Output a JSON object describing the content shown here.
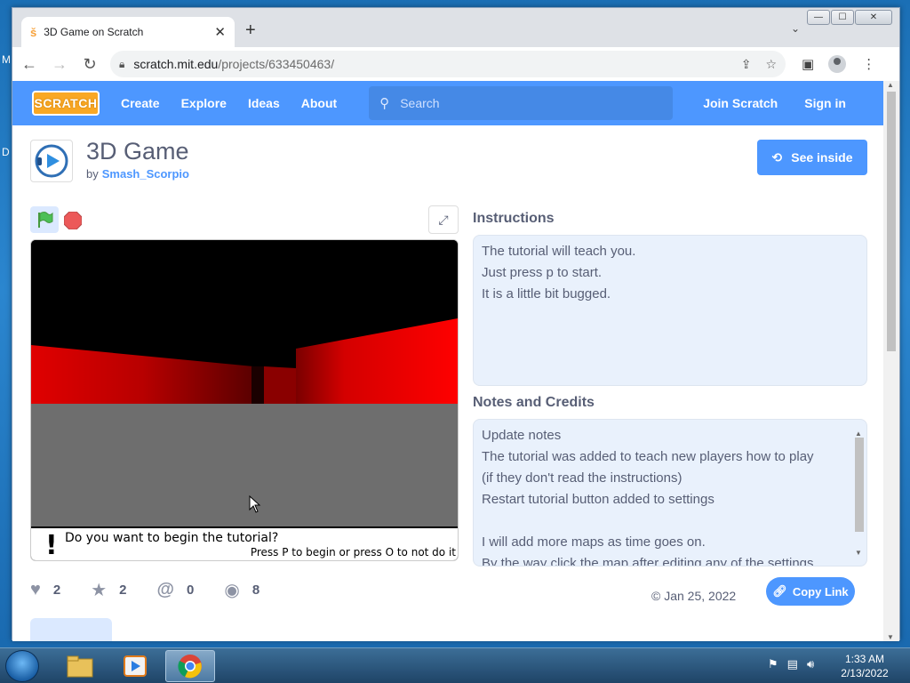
{
  "desktop": {
    "glyphs": [
      "M",
      "D"
    ]
  },
  "browser": {
    "tab_title": "3D Game on Scratch",
    "tab_favicon": "scratch-icon",
    "new_tab_label": "+",
    "url_host": "scratch.mit.edu",
    "url_path": "/projects/633450463/",
    "window_buttons": {
      "minimize": "—",
      "maximize": "☐",
      "close": "✕"
    }
  },
  "nav": {
    "logo": "SCRATCH",
    "links": [
      "Create",
      "Explore",
      "Ideas",
      "About"
    ],
    "search_placeholder": "Search",
    "join": "Join Scratch",
    "signin": "Sign in"
  },
  "project": {
    "title": "3D Game",
    "by_prefix": "by",
    "author": "Smash_Scorpio",
    "see_inside": "See inside"
  },
  "stage": {
    "question": "Do you want to begin the tutorial?",
    "hint": "Press P to begin or press O to not do it",
    "bang": "!"
  },
  "instructions": {
    "heading": "Instructions",
    "lines": [
      "The tutorial will teach you.",
      "Just press p to start.",
      "It is a little bit bugged."
    ]
  },
  "notes": {
    "heading": "Notes and Credits",
    "lines": [
      "Update notes",
      "The tutorial was added to teach new players how to play",
      "(if they don't read the instructions)",
      "Restart tutorial button added to settings",
      "",
      "I will add more maps as time goes on.",
      "By the way click the map after editing any of the settings"
    ]
  },
  "stats": {
    "loves": "2",
    "favorites": "2",
    "remixes": "0",
    "views": "8"
  },
  "shared_date": "Jan 25, 2022",
  "copy_link": "Copy Link",
  "taskbar": {
    "time": "1:33 AM",
    "date": "2/13/2022"
  },
  "colors": {
    "scratch_blue": "#4d97ff",
    "logo_orange": "#f9a825",
    "floor": "#6e6e6e",
    "wall_red": "#e00000"
  }
}
